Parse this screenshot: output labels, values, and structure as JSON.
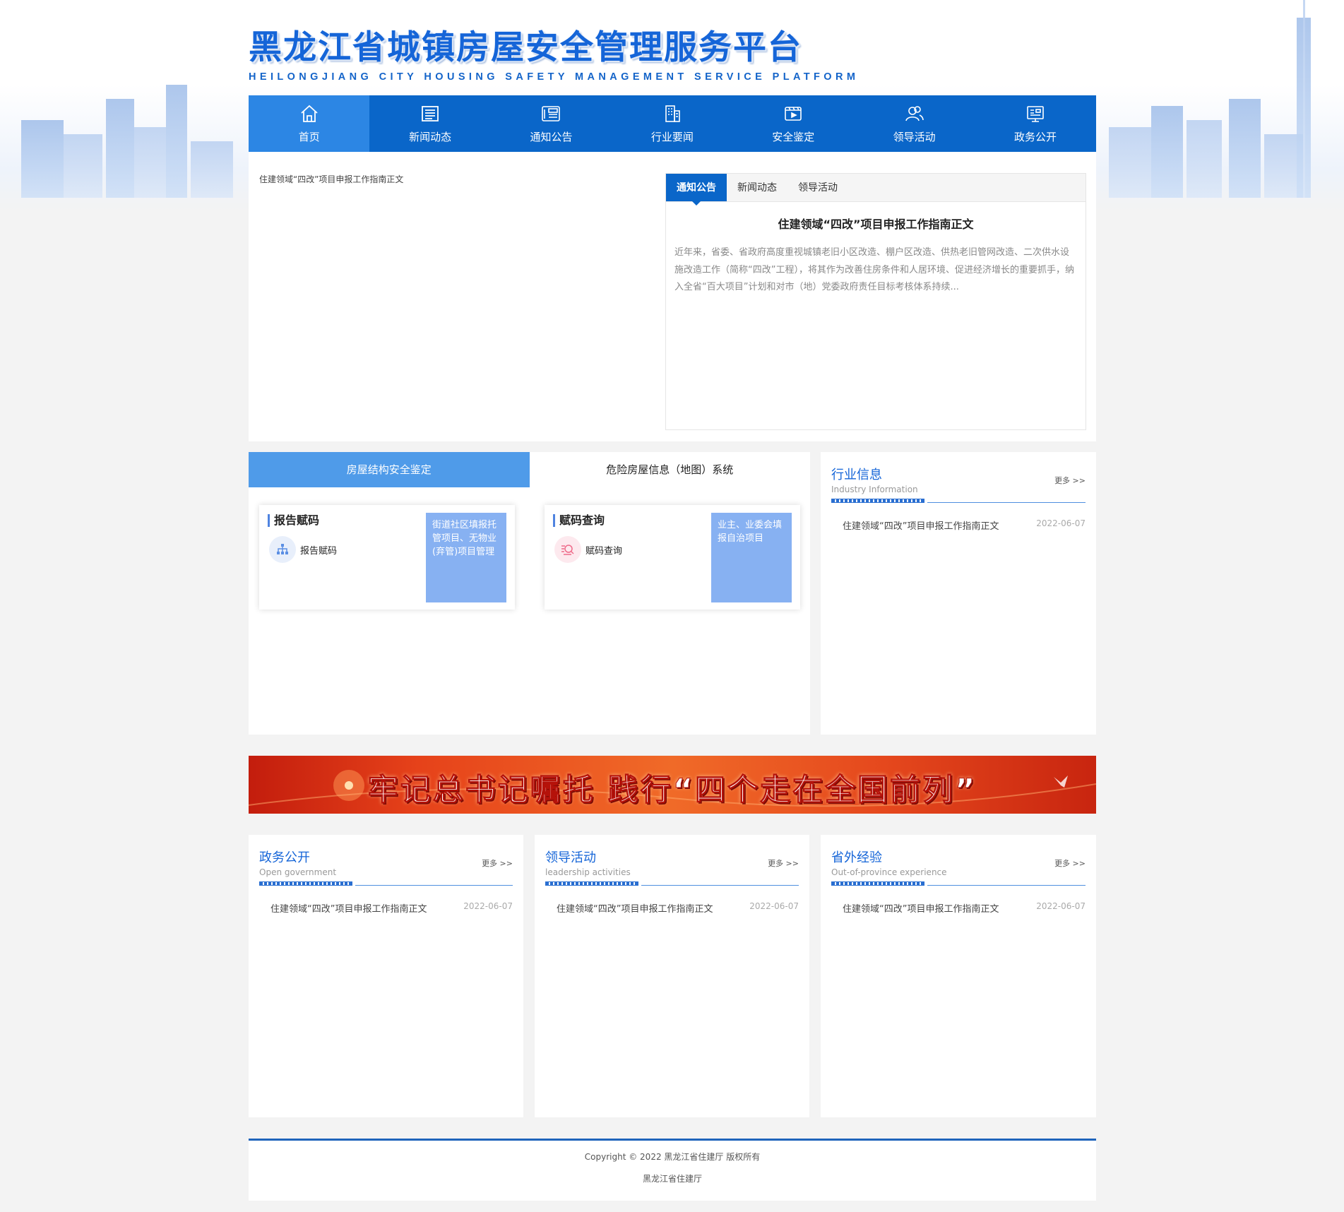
{
  "header": {
    "title_cn": "黑龙江省城镇房屋安全管理服务平台",
    "title_en": "HEILONGJIANG CITY HOUSING SAFETY MANAGEMENT SERVICE PLATFORM"
  },
  "nav": {
    "items": [
      {
        "label": "首页",
        "icon": "home-icon"
      },
      {
        "label": "新闻动态",
        "icon": "news-list-icon"
      },
      {
        "label": "通知公告",
        "icon": "newspaper-icon"
      },
      {
        "label": "行业要闻",
        "icon": "building-icon"
      },
      {
        "label": "安全鉴定",
        "icon": "video-icon"
      },
      {
        "label": "领导活动",
        "icon": "users-icon"
      },
      {
        "label": "政务公开",
        "icon": "monitor-icon"
      }
    ]
  },
  "slideshow": {
    "caption": "住建领域“四改”项目申报工作指南正文"
  },
  "news_tabs": {
    "tabs": [
      "通知公告",
      "新闻动态",
      "领导活动"
    ],
    "article_title": "住建领域“四改”项目申报工作指南正文",
    "article_body": "近年来，省委、省政府高度重视城镇老旧小区改造、棚户区改造、供热老旧管网改造、二次供水设施改造工作（简称“四改”工程），将其作为改善住房条件和人居环境、促进经济增长的重要抓手，纳入全省“百大项目”计划和对市（地）党委政府责任目标考核体系持续..."
  },
  "systems": {
    "tabs": [
      "房屋结构安全鉴定",
      "危险房屋信息（地图）系统"
    ],
    "cards": [
      {
        "title": "报告赋码",
        "link": "报告赋码",
        "side": "街道社区填报托管项目、无物业(弃管)项目管理"
      },
      {
        "title": "赋码查询",
        "link": "赋码查询",
        "side": "业主、业委会填报自治项目"
      }
    ]
  },
  "panels": {
    "industry": {
      "title": "行业信息",
      "subtitle": "Industry Information",
      "more": "更多 >>",
      "item": "住建领域“四改”项目申报工作指南正文",
      "date": "2022-06-07"
    },
    "gov": {
      "title": "政务公开",
      "subtitle": "Open government",
      "more": "更多 >>",
      "item": "住建领域“四改”项目申报工作指南正文",
      "date": "2022-06-07"
    },
    "leader": {
      "title": "领导活动",
      "subtitle": "leadership activities",
      "more": "更多 >>",
      "item": "住建领域“四改”项目申报工作指南正文",
      "date": "2022-06-07"
    },
    "outside": {
      "title": "省外经验",
      "subtitle": "Out-of-province experience",
      "more": "更多 >>",
      "item": "住建领域“四改”项目申报工作指南正文",
      "date": "2022-06-07"
    }
  },
  "banner": {
    "text": "牢记总书记嘱托 践行“四个走在全国前列”"
  },
  "footer": {
    "copyright": "Copyright © 2022 黑龙江省住建厅 版权所有",
    "org": "黑龙江省住建厅"
  },
  "colors": {
    "primary": "#0a66c9",
    "nav_active": "#2c86e4",
    "tab_light": "#4f9be9",
    "card_side": "#87b1f2"
  }
}
